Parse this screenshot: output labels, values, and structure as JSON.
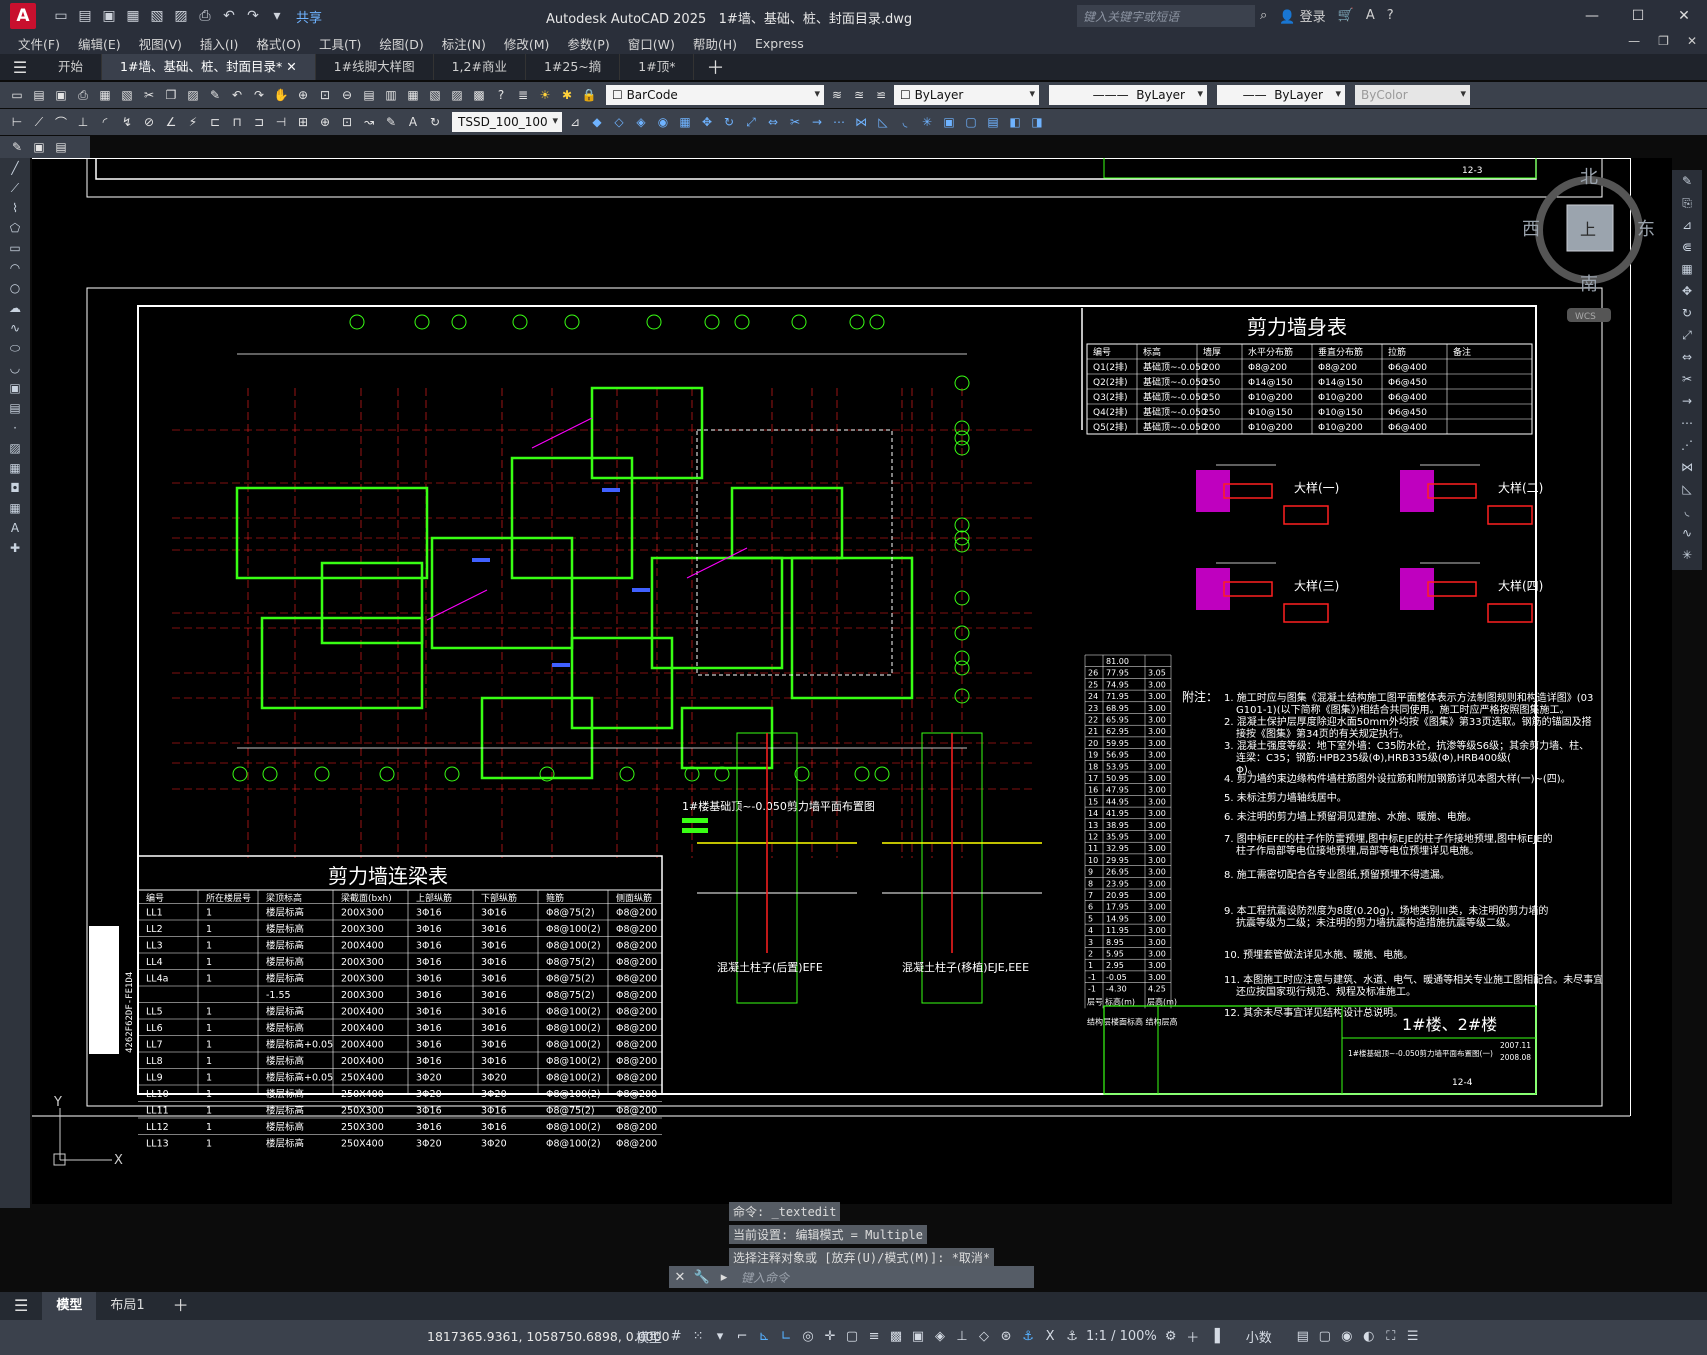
{
  "app": {
    "title": "Autodesk AutoCAD 2025",
    "document": "1#墙、基础、桩、封面目录.dwg",
    "logo": "A",
    "share": "共享",
    "search_placeholder": "键入关键字或短语",
    "login": "登录"
  },
  "menu": [
    "文件(F)",
    "编辑(E)",
    "视图(V)",
    "插入(I)",
    "格式(O)",
    "工具(T)",
    "绘图(D)",
    "标注(N)",
    "修改(M)",
    "参数(P)",
    "窗口(W)",
    "帮助(H)",
    "Express"
  ],
  "tabs": [
    "开始",
    "1#墙、基础、桩、封面目录*",
    "1#线脚大样图",
    "1,2#商业",
    "1#25~摘",
    "1#顶*"
  ],
  "toolbar": {
    "textstyle": "BarCode",
    "dimstyle": "TSSD_100_100",
    "color": "ByLayer",
    "linetype": "ByLayer",
    "lineweight": "ByLayer",
    "plotstyle": "ByColor"
  },
  "viewcube": {
    "north": "北",
    "south": "南",
    "east": "东",
    "west": "西",
    "top": "上",
    "wcs": "WCS"
  },
  "drawing": {
    "wall_body_table": {
      "title": "剪力墙身表",
      "headers": [
        "编号",
        "标高",
        "墙厚",
        "水平分布筋",
        "垂直分布筋",
        "拉筋",
        "备注"
      ],
      "rows": [
        [
          "Q1(2排)",
          "基础顶~-0.050",
          "200",
          "Φ8@200",
          "Φ8@200",
          "Φ6@400",
          ""
        ],
        [
          "Q2(2排)",
          "基础顶~-0.050",
          "250",
          "Φ14@150",
          "Φ14@150",
          "Φ6@450",
          ""
        ],
        [
          "Q3(2排)",
          "基础顶~-0.050",
          "250",
          "Φ10@200",
          "Φ10@200",
          "Φ6@400",
          ""
        ],
        [
          "Q4(2排)",
          "基础顶~-0.050",
          "250",
          "Φ10@150",
          "Φ10@150",
          "Φ6@450",
          ""
        ],
        [
          "Q5(2排)",
          "基础顶~-0.050",
          "200",
          "Φ10@200",
          "Φ10@200",
          "Φ6@400",
          ""
        ]
      ]
    },
    "beam_table": {
      "title": "剪力墙连梁表",
      "headers": [
        "编号",
        "所在楼层号",
        "梁顶标高",
        "梁截面(bxh)",
        "上部纵筋",
        "下部纵筋",
        "箍筋",
        "侧面纵筋"
      ],
      "rows": [
        [
          "LL1",
          "1",
          "楼层标高",
          "200X300",
          "3Φ16",
          "3Φ16",
          "Φ8@75(2)",
          "Φ8@200"
        ],
        [
          "LL2",
          "1",
          "楼层标高",
          "200X300",
          "3Φ16",
          "3Φ16",
          "Φ8@100(2)",
          "Φ8@200"
        ],
        [
          "LL3",
          "1",
          "楼层标高",
          "200X400",
          "3Φ16",
          "3Φ16",
          "Φ8@100(2)",
          "Φ8@200"
        ],
        [
          "LL4",
          "1",
          "楼层标高",
          "200X300",
          "3Φ16",
          "3Φ16",
          "Φ8@75(2)",
          "Φ8@200"
        ],
        [
          "LL4a",
          "1",
          "楼层标高",
          "200X300",
          "3Φ16",
          "3Φ16",
          "Φ8@75(2)",
          "Φ8@200"
        ],
        [
          "",
          "",
          "-1.55",
          "200X300",
          "3Φ16",
          "3Φ16",
          "Φ8@75(2)",
          "Φ8@200"
        ],
        [
          "LL5",
          "1",
          "楼层标高",
          "200X400",
          "3Φ16",
          "3Φ16",
          "Φ8@100(2)",
          "Φ8@200"
        ],
        [
          "LL6",
          "1",
          "楼层标高",
          "200X400",
          "3Φ16",
          "3Φ16",
          "Φ8@100(2)",
          "Φ8@200"
        ],
        [
          "LL7",
          "1",
          "楼层标高+0.05",
          "200X400",
          "3Φ16",
          "3Φ16",
          "Φ8@100(2)",
          "Φ8@200"
        ],
        [
          "LL8",
          "1",
          "楼层标高",
          "200X400",
          "3Φ16",
          "3Φ16",
          "Φ8@100(2)",
          "Φ8@200"
        ],
        [
          "LL9",
          "1",
          "楼层标高+0.05",
          "250X400",
          "3Φ20",
          "3Φ20",
          "Φ8@100(2)",
          "Φ8@200"
        ],
        [
          "LL10",
          "1",
          "楼层标高",
          "250X400",
          "3Φ20",
          "3Φ20",
          "Φ8@100(2)",
          "Φ8@200"
        ],
        [
          "LL11",
          "1",
          "楼层标高",
          "250X300",
          "3Φ16",
          "3Φ16",
          "Φ8@75(2)",
          "Φ8@200"
        ],
        [
          "LL12",
          "1",
          "楼层标高",
          "250X300",
          "3Φ16",
          "3Φ16",
          "Φ8@100(2)",
          "Φ8@200"
        ],
        [
          "LL13",
          "1",
          "楼层标高",
          "250X400",
          "3Φ20",
          "3Φ20",
          "Φ8@100(2)",
          "Φ8@200"
        ]
      ]
    },
    "plan_caption": "1#楼基础顶~-0.050剪力墙平面布置图",
    "details": [
      "大样(一)",
      "大样(二)",
      "大样(三)",
      "大样(四)"
    ],
    "section_captions": [
      "混凝土柱子(后置)EFE",
      "混凝土柱子(移植)EJE,EEE"
    ],
    "floor_table": {
      "rows": [
        [
          "",
          "81.00",
          ""
        ],
        [
          "26",
          "77.95",
          "3.05"
        ],
        [
          "25",
          "74.95",
          "3.00"
        ],
        [
          "24",
          "71.95",
          "3.00"
        ],
        [
          "23",
          "68.95",
          "3.00"
        ],
        [
          "22",
          "65.95",
          "3.00"
        ],
        [
          "21",
          "62.95",
          "3.00"
        ],
        [
          "20",
          "59.95",
          "3.00"
        ],
        [
          "19",
          "56.95",
          "3.00"
        ],
        [
          "18",
          "53.95",
          "3.00"
        ],
        [
          "17",
          "50.95",
          "3.00"
        ],
        [
          "16",
          "47.95",
          "3.00"
        ],
        [
          "15",
          "44.95",
          "3.00"
        ],
        [
          "14",
          "41.95",
          "3.00"
        ],
        [
          "13",
          "38.95",
          "3.00"
        ],
        [
          "12",
          "35.95",
          "3.00"
        ],
        [
          "11",
          "32.95",
          "3.00"
        ],
        [
          "10",
          "29.95",
          "3.00"
        ],
        [
          "9",
          "26.95",
          "3.00"
        ],
        [
          "8",
          "23.95",
          "3.00"
        ],
        [
          "7",
          "20.95",
          "3.00"
        ],
        [
          "6",
          "17.95",
          "3.00"
        ],
        [
          "5",
          "14.95",
          "3.00"
        ],
        [
          "4",
          "11.95",
          "3.00"
        ],
        [
          "3",
          "8.95",
          "3.00"
        ],
        [
          "2",
          "5.95",
          "3.00"
        ],
        [
          "1",
          "2.95",
          "3.00"
        ],
        [
          "-1",
          "-0.05",
          "3.00"
        ],
        [
          "-1",
          "-4.30",
          "4.25"
        ]
      ],
      "footer": [
        "层号",
        "标高(m)",
        "层高(m)"
      ],
      "caption": "结构层楼面标高 结构层高"
    },
    "notes_title": "附注：",
    "notes": [
      "1. 施工时应与图集《混凝土结构施工图平面整体表示方法制图规则和构造详图》(03G101-1)(以下简称《图集》)相结合共同使用。施工时应严格按照图集施工。",
      "2. 混凝土保护层厚度除迎水面50mm外均按《图集》第33页选取。钢筋的锚固及搭接按《图集》第34页的有关规定执行。",
      "3. 混凝土强度等级：地下室外墙：C35防水砼，抗渗等级S6级；其余剪力墙、柱、连梁：C35；钢筋:HPB235级(Φ),HRB335级(Φ),HRB400级(Φ)。",
      "4. 剪力墙约束边缘构件墙柱筋图外设拉筋和附加钢筋详见本图大样(一)~(四)。",
      "5. 未标注剪力墙轴线居中。",
      "6. 未注明的剪力墙上预留洞见建施、水施、暖施、电施。",
      "7. 图中标EFE的柱子作防雷预埋,图中标EJE的柱子作接地预埋,图中标EJE的柱子作局部等电位接地预埋,局部等电位预埋详见电施。",
      "8. 施工需密切配合各专业图纸,预留预埋不得遗漏。",
      "9. 本工程抗震设防烈度为8度(0.20g)，场地类别III类，未注明的剪力墙的抗震等级为二级；未注明的剪力墙抗震构造措施抗震等级二级。",
      "10. 预埋套管做法详见水施、暖施、电施。",
      "11. 本图施工时应注意与建筑、水道、电气、暖通等相关专业施工图相配合。未尽事宜还应按国家现行规范、规程及标准施工。",
      "12. 其余未尽事宜详见结构设计总说明。"
    ],
    "title_block": {
      "project": "1#楼、2#楼",
      "sheet": "1#楼基础顶~-0.050剪力墙平面布置图(一)",
      "date1": "2007.11",
      "date2": "2008.08",
      "num": "12-4",
      "page": "12-3"
    },
    "barcode_text": "4262F62DF-FE1D4"
  },
  "command": {
    "history": [
      "命令: _textedit",
      "当前设置: 编辑模式 = Multiple",
      "选择注释对象或 [放弃(U)/模式(M)]: *取消*"
    ],
    "placeholder": "键入命令"
  },
  "layouts": [
    "模型",
    "布局1"
  ],
  "status": {
    "coords": "1817365.9361, 1058750.6898, 0.0000",
    "mode": "模型",
    "scale": "1:1 / 100%",
    "units": "小数"
  },
  "colors": {
    "green": "#39ff14",
    "white": "#ffffff",
    "magenta": "#ff00ff",
    "red": "#ff2020",
    "yellow": "#ffff00",
    "blue": "#4060ff"
  }
}
